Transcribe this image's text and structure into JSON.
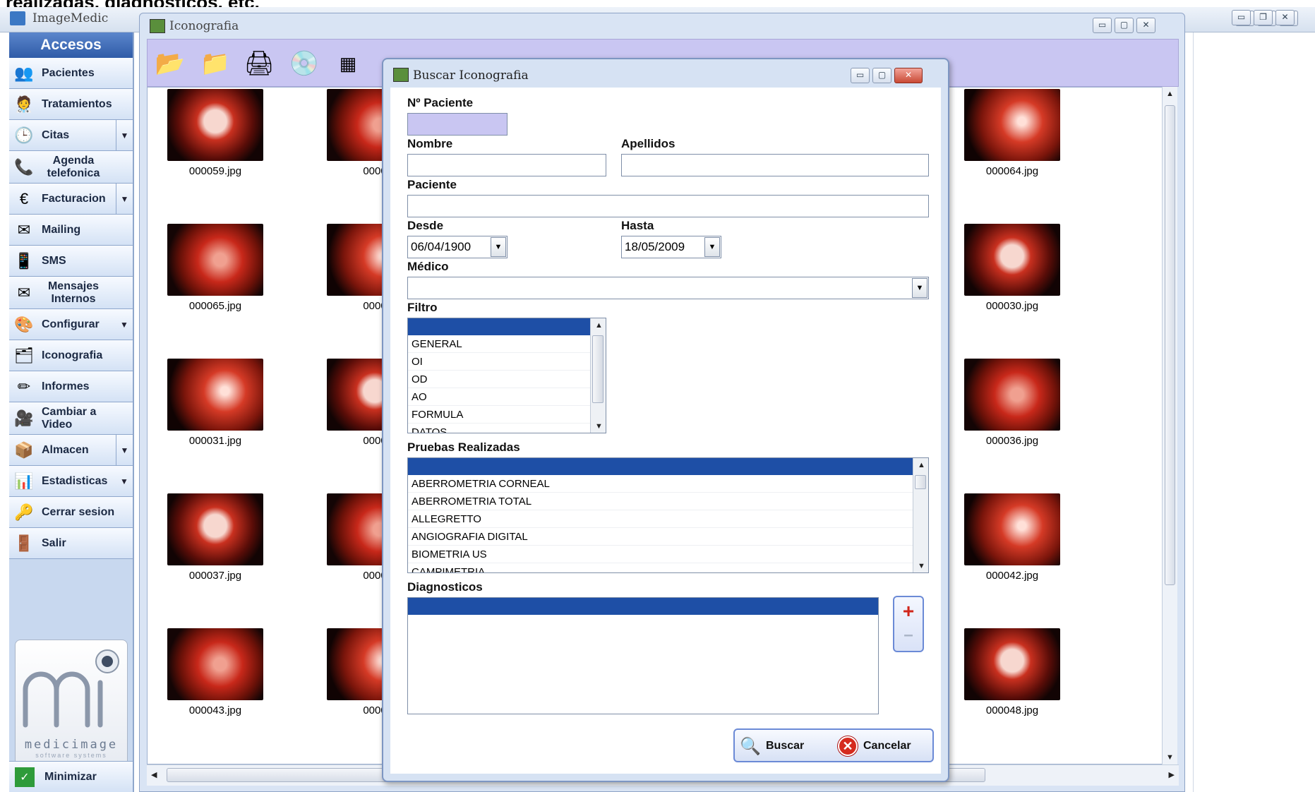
{
  "caption": "realizadas, diagnosticos, etc.",
  "app": {
    "title": "ImageMedic"
  },
  "sidebar": {
    "header": "Accesos",
    "items": [
      {
        "label": "Pacientes",
        "icon": "patients-icon"
      },
      {
        "label": "Tratamientos",
        "icon": "treatments-icon"
      },
      {
        "label": "Citas",
        "icon": "clock-icon"
      },
      {
        "label": "Agenda telefonica",
        "icon": "phone-book-icon"
      },
      {
        "label": "Facturacion",
        "icon": "invoice-icon"
      },
      {
        "label": "Mailing",
        "icon": "mail-icon"
      },
      {
        "label": "SMS",
        "icon": "sms-icon"
      },
      {
        "label": "Mensajes Internos",
        "icon": "envelope-icon"
      },
      {
        "label": "Configurar",
        "icon": "palette-icon"
      },
      {
        "label": "Iconografia",
        "icon": "folder-icon"
      },
      {
        "label": "Informes",
        "icon": "pencil-icon"
      },
      {
        "label": "Cambiar a Video",
        "icon": "video-icon"
      },
      {
        "label": "Almacen",
        "icon": "box-icon"
      },
      {
        "label": "Estadisticas",
        "icon": "bar-chart-icon"
      },
      {
        "label": "Cerrar sesion",
        "icon": "logout-icon"
      },
      {
        "label": "Salir",
        "icon": "exit-door-icon"
      }
    ],
    "logo_name": "medicimage",
    "logo_tag": "software systems",
    "minimize": "Minimizar"
  },
  "iconografia": {
    "title": "Iconografia",
    "thumbs_left": [
      "000059.jpg",
      "000065.jpg",
      "000031.jpg",
      "000037.jpg",
      "000043.jpg"
    ],
    "thumbs_mid": [
      "0000",
      "0000",
      "0000",
      "0000",
      "0000"
    ],
    "thumbs_right": [
      "000064.jpg",
      "000030.jpg",
      "000036.jpg",
      "000042.jpg",
      "000048.jpg"
    ]
  },
  "dialog": {
    "title": "Buscar Iconografia",
    "n_paciente_label": "Nº Paciente",
    "nombre_label": "Nombre",
    "apellidos_label": "Apellidos",
    "paciente_label": "Paciente",
    "desde_label": "Desde",
    "desde_value": "06/04/1900",
    "hasta_label": "Hasta",
    "hasta_value": "18/05/2009",
    "medico_label": "Médico",
    "filtro_label": "Filtro",
    "filtro_items": [
      "GENERAL",
      "OI",
      "OD",
      "AO",
      "FORMULA",
      "DATOS"
    ],
    "pruebas_label": "Pruebas Realizadas",
    "pruebas_items": [
      "ABERROMETRIA CORNEAL",
      "ABERROMETRIA TOTAL",
      "ALLEGRETTO",
      "ANGIOGRAFIA DIGITAL",
      "BIOMETRIA US",
      "CAMPIMETRIA"
    ],
    "diagnosticos_label": "Diagnosticos",
    "plus": "+",
    "minus": "–",
    "buscar": "Buscar",
    "cancelar": "Cancelar"
  },
  "colors": {
    "accent": "#1e4fa6",
    "toolbar": "#c9c6f2",
    "sidebar": "#c8d8ef"
  }
}
